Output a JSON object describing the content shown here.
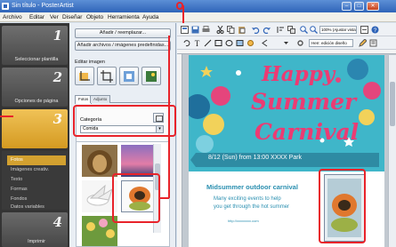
{
  "window": {
    "title": "Sin título - PosterArtist",
    "minimize_glyph": "–",
    "maximize_glyph": "□",
    "close_glyph": "✕"
  },
  "menu": [
    "Archivo",
    "Editar",
    "Ver",
    "Diseñar",
    "Objeto",
    "Herramienta",
    "Ayuda"
  ],
  "steps": {
    "step1": {
      "number": "1",
      "label": "Seleccionar plantilla"
    },
    "step2": {
      "number": "2",
      "label": "Opciones de página"
    },
    "step3": {
      "number": "3",
      "items": [
        "Fotos",
        "Imágenes creativ.",
        "Texto",
        "Formas",
        "Fondos",
        "Datos variables"
      ],
      "active_item": "Fotos"
    },
    "step4": {
      "number": "4",
      "label": "Imprimir"
    }
  },
  "gallery": {
    "add_button": "Añadir / reemplazar...",
    "add_predefined_button": "Añadir archivos / imágenes predefinidas...",
    "edit_images_label": "Editar imagen",
    "tabs": [
      "Fotos",
      "Adjunto"
    ],
    "active_tab": "Fotos",
    "category_label": "Categoría",
    "category_value": "Comida",
    "thumbnails": [
      "lion",
      "sunset-sky",
      "bird",
      "papaya",
      "flowers"
    ],
    "selected_thumbnail": "papaya"
  },
  "toolbar": {
    "zoom_value": "100% (Ajustar vista)",
    "font_value": "Herr. edición diseño"
  },
  "flyer": {
    "title_line1": "Happy",
    "title_line2": "Summer",
    "title_line3": "Carnival",
    "date_line": "8/12 (Sun) from 13:00  XXXX Park",
    "subtitle": "Midsummer outdoor carnival",
    "body_line1": "Many exciting events to help",
    "body_line2": "you get through the hot summer",
    "url": "http://xxxxxxxx.com",
    "colors": {
      "background": "#3fb6c9",
      "title": "#ec3b73",
      "ribbon": "#2e8ba3"
    }
  },
  "callouts": {
    "color": "#e8232a"
  }
}
